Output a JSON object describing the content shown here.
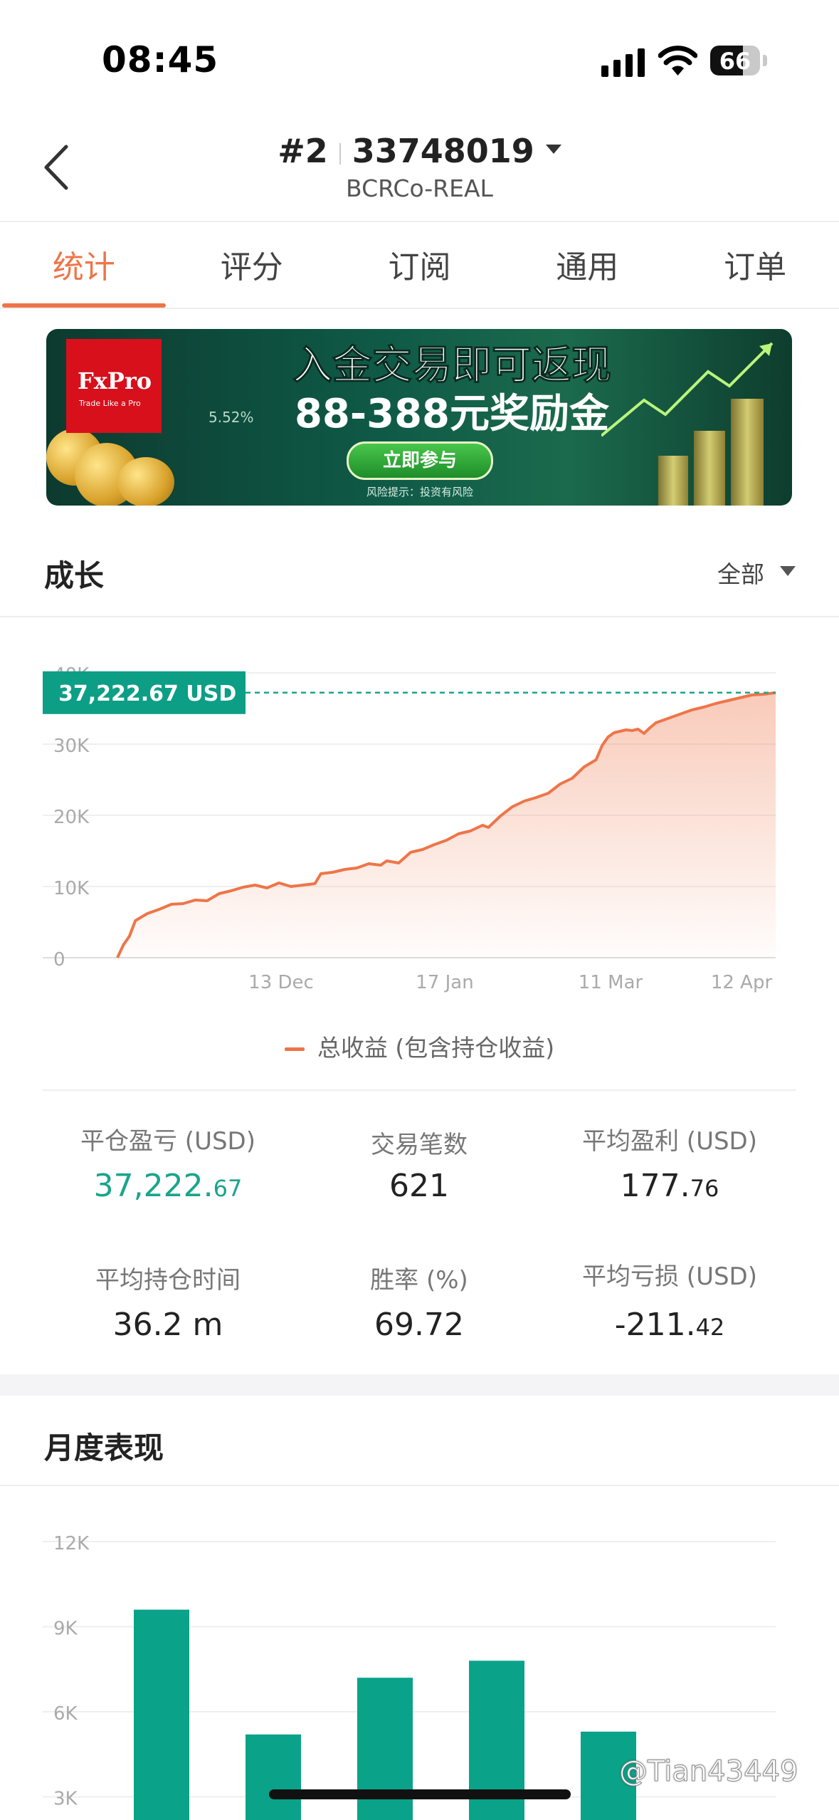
{
  "status_bar": {
    "time": "08:45",
    "battery": "66"
  },
  "header": {
    "rank": "#2",
    "account": "33748019",
    "server": "BCRCo-REAL"
  },
  "tabs": [
    {
      "label": "统计",
      "active": true
    },
    {
      "label": "评分",
      "active": false
    },
    {
      "label": "订阅",
      "active": false
    },
    {
      "label": "通用",
      "active": false
    },
    {
      "label": "订单",
      "active": false
    }
  ],
  "banner": {
    "logo": "FxPro",
    "logo_tagline": "Trade Like a Pro",
    "percent": "5.52%",
    "line1": "入金交易即可返现",
    "line2": "88-388元奖励金",
    "cta": "立即参与",
    "risk": "风险提示：投资有风险"
  },
  "growth": {
    "title": "成长",
    "filter": "全部",
    "current_value_label": "37,222.67 USD",
    "legend": "总收益 (包含持仓收益)"
  },
  "chart_data": [
    {
      "type": "area",
      "y_ticks": [
        "0",
        "10K",
        "20K",
        "30K",
        "40K"
      ],
      "x_ticks": [
        "13 Dec",
        "17 Jan",
        "11 Mar",
        "12 Apr"
      ],
      "ylim": [
        0,
        40000
      ],
      "series": [
        {
          "name": "总收益 (包含持仓收益)",
          "color": "#ee7548",
          "points": [
            [
              0,
              0
            ],
            [
              0.01,
              1800
            ],
            [
              0.02,
              3000
            ],
            [
              0.03,
              5200
            ],
            [
              0.05,
              6200
            ],
            [
              0.07,
              6800
            ],
            [
              0.09,
              7500
            ],
            [
              0.11,
              7600
            ],
            [
              0.13,
              8100
            ],
            [
              0.15,
              8000
            ],
            [
              0.17,
              9000
            ],
            [
              0.19,
              9400
            ],
            [
              0.21,
              9900
            ],
            [
              0.23,
              10200
            ],
            [
              0.25,
              9800
            ],
            [
              0.27,
              10500
            ],
            [
              0.29,
              10000
            ],
            [
              0.31,
              10200
            ],
            [
              0.33,
              10400
            ],
            [
              0.34,
              11800
            ],
            [
              0.36,
              12000
            ],
            [
              0.38,
              12400
            ],
            [
              0.4,
              12600
            ],
            [
              0.42,
              13200
            ],
            [
              0.44,
              13000
            ],
            [
              0.45,
              13600
            ],
            [
              0.47,
              13300
            ],
            [
              0.49,
              14800
            ],
            [
              0.51,
              15200
            ],
            [
              0.53,
              15900
            ],
            [
              0.55,
              16500
            ],
            [
              0.57,
              17400
            ],
            [
              0.59,
              17800
            ],
            [
              0.61,
              18600
            ],
            [
              0.62,
              18300
            ],
            [
              0.64,
              19900
            ],
            [
              0.66,
              21200
            ],
            [
              0.68,
              22000
            ],
            [
              0.7,
              22500
            ],
            [
              0.72,
              23100
            ],
            [
              0.74,
              24400
            ],
            [
              0.76,
              25200
            ],
            [
              0.78,
              26800
            ],
            [
              0.79,
              27300
            ],
            [
              0.8,
              27800
            ],
            [
              0.81,
              29800
            ],
            [
              0.82,
              31000
            ],
            [
              0.83,
              31600
            ],
            [
              0.85,
              32000
            ],
            [
              0.86,
              31900
            ],
            [
              0.87,
              32100
            ],
            [
              0.88,
              31500
            ],
            [
              0.89,
              32300
            ],
            [
              0.9,
              33000
            ],
            [
              0.92,
              33600
            ],
            [
              0.94,
              34200
            ],
            [
              0.96,
              34800
            ],
            [
              0.98,
              35200
            ],
            [
              1.0,
              35700
            ],
            [
              1.02,
              36100
            ],
            [
              1.04,
              36500
            ],
            [
              1.06,
              36900
            ],
            [
              1.08,
              37000
            ],
            [
              1.1,
              37222.67
            ]
          ]
        }
      ]
    },
    {
      "type": "bar",
      "y_ticks": [
        "3K",
        "6K",
        "9K",
        "12K"
      ],
      "ylim": [
        0,
        12000
      ],
      "values": [
        9600,
        5200,
        7200,
        7800,
        5300
      ],
      "color": "#0aa389"
    }
  ],
  "stats": [
    {
      "label": "平仓盈亏 (USD)",
      "int": "37,222.",
      "dec": "67",
      "green": true
    },
    {
      "label": "交易笔数",
      "int": "621",
      "dec": "",
      "green": false
    },
    {
      "label": "平均盈利 (USD)",
      "int": "177.",
      "dec": "76",
      "green": false
    },
    {
      "label": "平均持仓时间",
      "int": "36.2 m",
      "dec": "",
      "green": false
    },
    {
      "label": "胜率 (%)",
      "int": "69.72",
      "dec": "",
      "green": false
    },
    {
      "label": "平均亏损 (USD)",
      "int": "-211.",
      "dec": "42",
      "green": false
    }
  ],
  "monthly": {
    "title": "月度表现"
  },
  "watermark": "@Tian43449",
  "icons": [
    "back-chevron-icon",
    "caret-down-icon",
    "signal-icon",
    "wifi-icon",
    "battery-icon"
  ]
}
